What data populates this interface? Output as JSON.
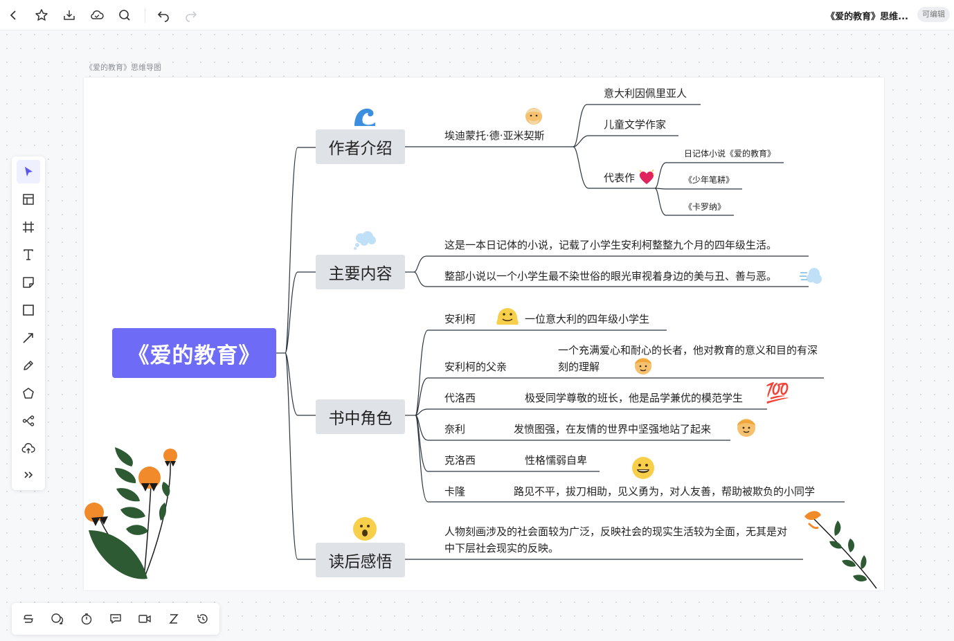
{
  "toolbar": {
    "doc_title": "《爱的教育》思维...",
    "edit_badge": "可编辑"
  },
  "frame": {
    "label": "《爱的教育》思维导图"
  },
  "mindmap": {
    "root": "《爱的教育》",
    "author": {
      "label": "作者介绍",
      "name": "埃迪蒙托·德·亚米契斯",
      "details": {
        "origin": "意大利因佩里亚人",
        "role": "儿童文学作家",
        "works_label": "代表作",
        "works": [
          "日记体小说《爱的教育》",
          "《少年笔耕》",
          "《卡罗纳》"
        ]
      }
    },
    "content": {
      "label": "主要内容",
      "lines": [
        "这是一本日记体的小说，记载了小学生安利柯整整九个月的四年级生活。",
        "整部小说以一个小学生最不染世俗的眼光审视着身边的美与丑、善与恶。"
      ]
    },
    "characters": {
      "label": "书中角色",
      "items": [
        {
          "name": "安利柯",
          "desc": "一位意大利的四年级小学生"
        },
        {
          "name": "安利柯的父亲",
          "desc": "一个充满爱心和耐心的长者，他对教育的意义和目的有深刻的理解"
        },
        {
          "name": "代洛西",
          "desc": "极受同学尊敬的班长，他是品学兼优的模范学生"
        },
        {
          "name": "奈利",
          "desc": "发愤图强，在友情的世界中坚强地站了起来"
        },
        {
          "name": "克洛西",
          "desc": "性格懦弱自卑"
        },
        {
          "name": "卡隆",
          "desc": "路见不平，拔刀相助，见义勇为，对人友善，帮助被欺负的小同学"
        }
      ]
    },
    "reflection": {
      "label": "读后感悟",
      "text": "人物刻画涉及的社会面较为广泛，反映社会的现实生活较为全面，无其是对中下层社会现实的反映。"
    }
  },
  "emoji": {
    "hundred": "💯"
  },
  "colors": {
    "accent": "#6e6cf7",
    "node_bg": "#dfe2e7",
    "line": "#2c3440",
    "leaf_green": "#2d5a32",
    "flower_orange": "#f08a2a"
  },
  "icons": {
    "top": [
      "back-icon",
      "star-icon",
      "download-icon",
      "cloud-icon",
      "search-icon",
      "undo-icon",
      "redo-icon"
    ],
    "left": [
      "select-icon",
      "template-icon",
      "frame-icon",
      "text-icon",
      "sticky-note-icon",
      "rectangle-icon",
      "line-icon",
      "pen-icon",
      "polygon-icon",
      "mindmap-icon",
      "upload-icon",
      "more-icon"
    ],
    "bottom": [
      "strike-icon",
      "comments-icon",
      "timer-icon",
      "chat-icon",
      "video-icon",
      "sleep-icon",
      "history-icon"
    ]
  }
}
